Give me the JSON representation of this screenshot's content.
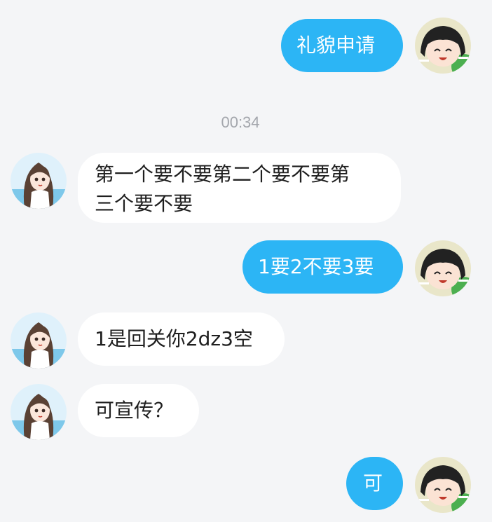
{
  "conversation": {
    "timestamp": "00:34",
    "messages": [
      {
        "sender": "me",
        "text": "礼貌申请"
      },
      {
        "sender": "other",
        "text_line1": "第一个要不要第二个要不要第",
        "text_line2": "三个要不要"
      },
      {
        "sender": "me",
        "text": "1要2不要3要"
      },
      {
        "sender": "other",
        "text": "1是回关你2dz3空"
      },
      {
        "sender": "other",
        "text": "可宣传？"
      },
      {
        "sender": "me",
        "text": "可"
      }
    ]
  },
  "colors": {
    "background": "#f4f5f7",
    "my_bubble": "#2cb5f5",
    "their_bubble": "#ffffff"
  },
  "icons": {
    "my_avatar": "anime-girl-bangs-avatar",
    "their_avatar": "anime-girl-long-hair-avatar"
  }
}
